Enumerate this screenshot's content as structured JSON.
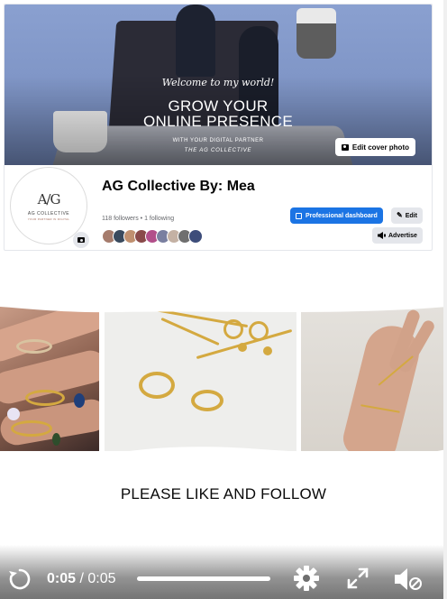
{
  "page": {
    "cover": {
      "welcome_text": "Welcome to my world!",
      "headline_line1": "GROW YOUR",
      "headline_line2": "ONLINE PRESENCE",
      "subline1": "WITH YOUR DIGITAL PARTNER",
      "subline2": "THE AG COLLECTIVE",
      "edit_cover_label": "Edit cover photo"
    },
    "avatar": {
      "monogram": "A/G",
      "brand": "AG COLLECTIVE",
      "brand_sub": "YOUR PARTNER IN DIGITAL"
    },
    "name": "AG Collective By: Mea",
    "followers_text": "118 followers • 1 following",
    "follower_faces": [
      "#a67c6d",
      "#3a4a5e",
      "#c09070",
      "#8a4a4a",
      "#b24f8a",
      "#7a7fa0",
      "#c4b1a4",
      "#6f6f6f",
      "#3d4d7a"
    ],
    "buttons": {
      "professional_dashboard": "Professional dashboard",
      "edit": "Edit",
      "advertise": "Advertise"
    }
  },
  "video": {
    "caption": "PLEASE LIKE AND FOLLOW",
    "current_time": "0:05",
    "separator": "/",
    "duration": "0:05",
    "progress": 1.0
  },
  "colors": {
    "accent": "#1b74e4",
    "gold": "#d4a940",
    "cover_blue": "#7f95c7"
  },
  "icons": [
    "camera-icon",
    "dashboard-icon",
    "pencil-icon",
    "megaphone-icon",
    "replay-icon",
    "gear-icon",
    "fullscreen-icon",
    "speaker-muted-icon"
  ]
}
